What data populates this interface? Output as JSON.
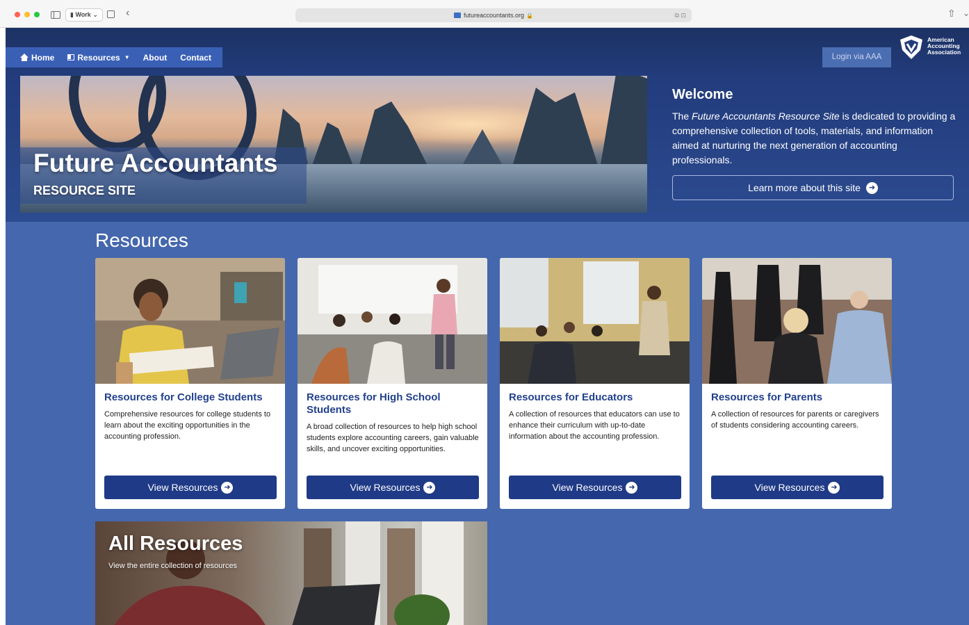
{
  "browser": {
    "profile_label": "Work",
    "profile_caret": "⌄",
    "url": "futureaccountants.org",
    "lock_icon": "🔒",
    "url_tools": "⧉ ⊡",
    "back_glyph": "‹",
    "share_glyph": "⇧",
    "more_glyph": "⌄"
  },
  "nav": {
    "items": [
      {
        "label": "Home",
        "icon": "home-icon"
      },
      {
        "label": "Resources",
        "icon": "book-icon",
        "has_dropdown": true
      },
      {
        "label": "About"
      },
      {
        "label": "Contact"
      }
    ],
    "caret": "▼",
    "login_label": "Login via AAA"
  },
  "logo": {
    "line1": "American",
    "line2": "Accounting",
    "line3": "Association"
  },
  "hero": {
    "title": "Future Accountants",
    "subtitle": "RESOURCE SITE"
  },
  "welcome": {
    "heading": "Welcome",
    "text_before": "The ",
    "text_emphasis": "Future Accountants Resource Site",
    "text_after": " is dedicated to providing a comprehensive collection of tools, materials, and information aimed at nurturing the next generation of accounting professionals.",
    "button_label": "Learn more about this site",
    "arrow_glyph": "➜"
  },
  "resources": {
    "heading": "Resources",
    "cards": [
      {
        "title": "Resources for College Students",
        "description": "Comprehensive resources for college students to learn about the exciting opportunities in the accounting profession.",
        "button_label": "View Resources"
      },
      {
        "title": "Resources for High School Students",
        "description": "A broad collection of resources to help high school students explore accounting careers, gain valuable skills, and uncover exciting opportunities.",
        "button_label": "View Resources"
      },
      {
        "title": "Resources for Educators",
        "description": "A collection of resources that educators can use to enhance their curriculum with up-to-date information about the accounting profession.",
        "button_label": "View Resources"
      },
      {
        "title": "Resources for Parents",
        "description": "A collection of resources for parents or caregivers of students considering accounting careers.",
        "button_label": "View Resources"
      }
    ],
    "all": {
      "title": "All Resources",
      "subtitle": "View the entire collection of resources"
    }
  },
  "colors": {
    "page_blue": "#4567ad",
    "hero_dark": "#223c7c",
    "nav_blue": "#3a60b6",
    "button_navy": "#1f3a86",
    "card_title": "#22418c"
  }
}
